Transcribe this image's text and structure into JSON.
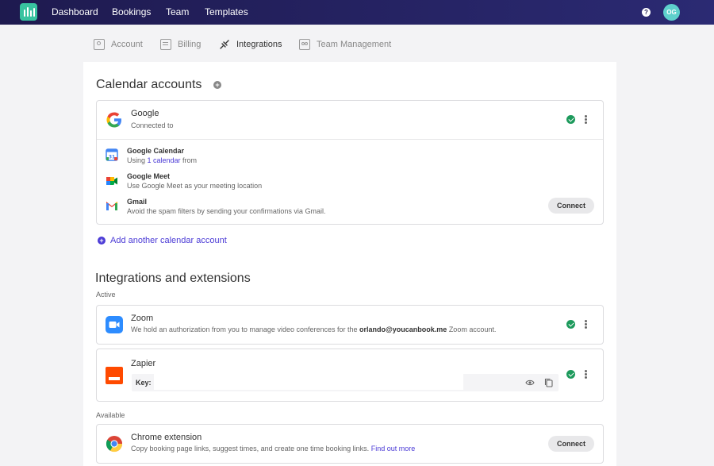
{
  "nav": {
    "items": [
      "Dashboard",
      "Bookings",
      "Team",
      "Templates"
    ],
    "help_label": "?",
    "avatar_initials": "OG"
  },
  "tabs": [
    "Account",
    "Billing",
    "Integrations",
    "Team Management"
  ],
  "active_tab": "Integrations",
  "calendar": {
    "title": "Calendar accounts",
    "add_icon_label": "+",
    "google": {
      "name": "Google",
      "status": "Connected to",
      "services": [
        {
          "name": "Google Calendar",
          "desc_prefix": "Using ",
          "desc_link": "1 calendar",
          "desc_suffix": " from"
        },
        {
          "name": "Google Meet",
          "desc": "Use Google Meet as your meeting location"
        },
        {
          "name": "Gmail",
          "desc": "Avoid the spam filters by sending your confirmations via Gmail.",
          "button": "Connect"
        }
      ]
    },
    "add_another": "Add another calendar account",
    "add_another_icon": "+"
  },
  "integrations": {
    "title": "Integrations and extensions",
    "active_label": "Active",
    "zoom": {
      "name": "Zoom",
      "desc_prefix": "We hold an authorization from you to manage video conferences for the ",
      "desc_email": "orlando@youcanbook.me",
      "desc_suffix": " Zoom account."
    },
    "zapier": {
      "name": "Zapier",
      "key_label": "Key:"
    },
    "available_label": "Available",
    "chrome": {
      "name": "Chrome extension",
      "desc": "Copy booking page links, suggest times, and create one time booking links.",
      "link": "Find out more",
      "button": "Connect"
    }
  },
  "colors": {
    "accent": "#4b3bd6",
    "success": "#1d9a5c",
    "nav_bg": "#1e1a4f"
  }
}
